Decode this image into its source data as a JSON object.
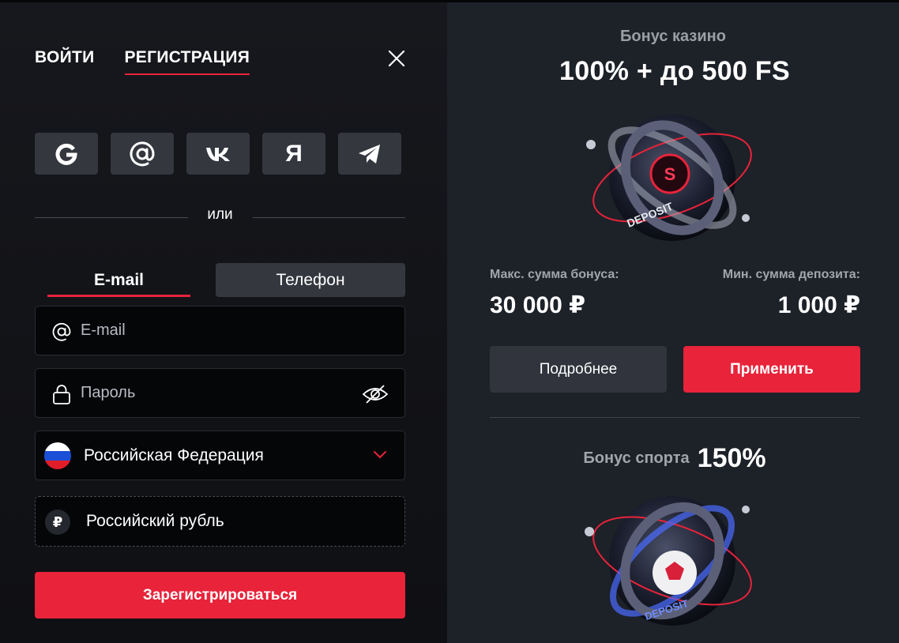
{
  "auth": {
    "tabs": [
      {
        "label": "ВОЙТИ",
        "active": false
      },
      {
        "label": "РЕГИСТРАЦИЯ",
        "active": true
      }
    ],
    "social_icons": [
      "google-icon",
      "mail-at-icon",
      "vk-icon",
      "yandex-icon",
      "telegram-icon"
    ],
    "yandex_glyph": "Я",
    "or_text": "или",
    "method_tabs": {
      "email": "E-mail",
      "phone": "Телефон"
    },
    "email_placeholder": "E-mail",
    "password_placeholder": "Пароль",
    "country": "Российская Федерация",
    "currency_symbol": "₽",
    "currency": "Российский рубль",
    "submit_label": "Зарегистрироваться"
  },
  "bonus": {
    "casino_subtitle": "Бонус казино",
    "casino_title": "100% + до 500 FS",
    "max_label": "Макс. сумма бонуса:",
    "max_value": "30 000 ₽",
    "min_label": "Мин. сумма депозита:",
    "min_value": "1 000 ₽",
    "more_label": "Подробнее",
    "apply_label": "Применить",
    "sport_label": "Бонус спорта",
    "sport_value": "150%",
    "orb_text": "DEPOSIT",
    "orb_badge": "S"
  },
  "colors": {
    "accent": "#e8233a",
    "left_bg": "#15161b",
    "right_bg": "#1d2128",
    "button_gray": "#35373f"
  }
}
